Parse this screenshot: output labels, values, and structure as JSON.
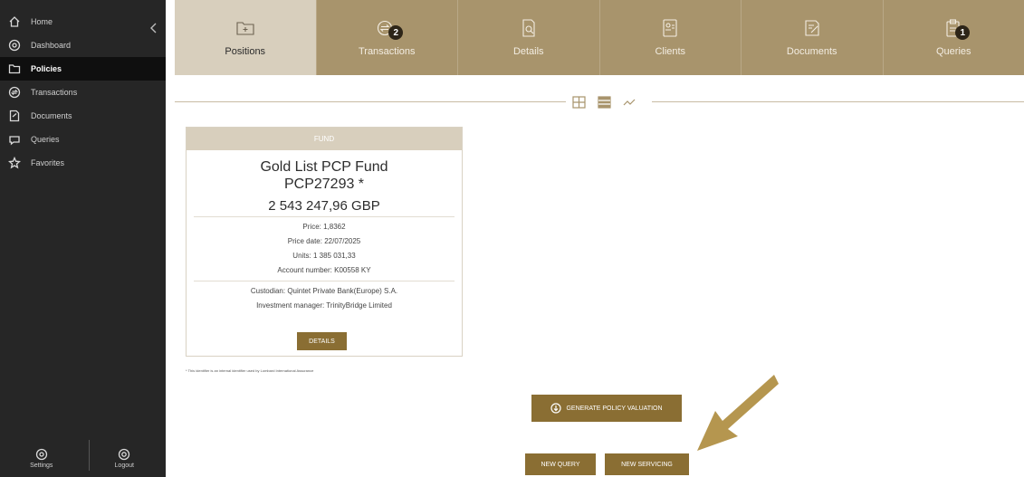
{
  "sidebar": {
    "items": [
      {
        "label": "Home",
        "icon": "home-icon"
      },
      {
        "label": "Dashboard",
        "icon": "dashboard-icon"
      },
      {
        "label": "Policies",
        "icon": "folder-icon",
        "active": true
      },
      {
        "label": "Transactions",
        "icon": "transactions-icon"
      },
      {
        "label": "Documents",
        "icon": "documents-icon"
      },
      {
        "label": "Queries",
        "icon": "queries-icon"
      },
      {
        "label": "Favorites",
        "icon": "star-icon"
      }
    ],
    "settings_label": "Settings",
    "logout_label": "Logout"
  },
  "tabs": [
    {
      "label": "Positions",
      "icon": "folder-icon",
      "active": true
    },
    {
      "label": "Transactions",
      "icon": "transactions-icon",
      "badge": "2"
    },
    {
      "label": "Details",
      "icon": "details-icon"
    },
    {
      "label": "Clients",
      "icon": "clients-icon"
    },
    {
      "label": "Documents",
      "icon": "documents-icon"
    },
    {
      "label": "Queries",
      "icon": "clipboard-icon",
      "badge": "1"
    }
  ],
  "view_toggle": [
    "grid-view-icon",
    "list-view-icon",
    "chart-view-icon"
  ],
  "card": {
    "header": "FUND",
    "name_line1": "Gold List PCP Fund",
    "name_line2": "PCP27293 *",
    "amount": "2 543 247,96 GBP",
    "price": "Price: 1,8362",
    "price_date": "Price date: 22/07/2025",
    "units": "Units: 1 385 031,33",
    "account": "Account number: K00558 KY",
    "custodian": "Custodian: Quintet Private Bank(Europe) S.A.",
    "manager": "Investment manager: TrinityBridge Limited",
    "details_label": "DETAILS"
  },
  "footnote": "* This identifier is an internal identifier used by Lombard International Assurance",
  "actions": {
    "generate_label": "GENERATE POLICY VALUATION",
    "new_query_label": "NEW QUERY",
    "new_servicing_label": "NEW SERVICING"
  },
  "colors": {
    "gold": "#a8946c",
    "gold_dark": "#8a6e33",
    "tab_active": "#d8cfbd",
    "sidebar": "#262626"
  }
}
